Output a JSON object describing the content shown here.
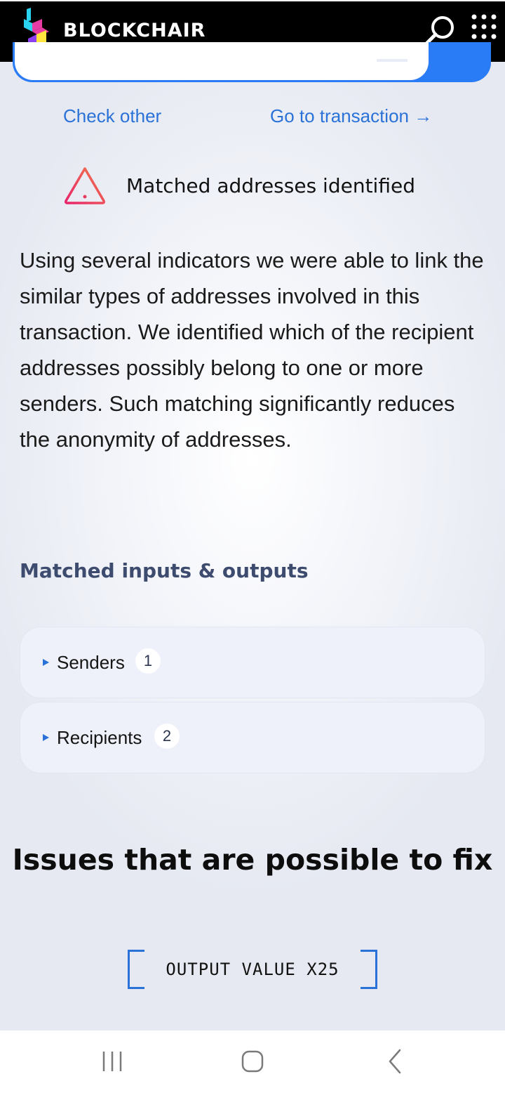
{
  "header": {
    "brand": "BLOCKCHAIR",
    "icons": [
      "blockchair-logo-icon",
      "search-icon",
      "apps-grid-icon"
    ],
    "colors": {
      "background": "#000000",
      "logo_cyan": "#2ad3f0",
      "logo_magenta": "#e83aa5",
      "logo_yellow": "#ffe53d",
      "logo_purple": "#8b3ff0"
    }
  },
  "search": {
    "accent": "#2a7cf6"
  },
  "links": {
    "check_other": "Check other",
    "go_to_transaction": "Go to transaction →"
  },
  "alert": {
    "title": "Matched addresses identified",
    "icon": "warning-triangle-icon",
    "body": "Using several indicators we were able to link the similar types of addresses involved in this transaction. We identified which of the recipient addresses possibly belong to one or more senders. Such matching significantly reduces the anonymity of addresses."
  },
  "matched": {
    "title": "Matched inputs & outputs",
    "groups": [
      {
        "label": "Senders",
        "count": "1"
      },
      {
        "label": "Recipients",
        "count": "2"
      }
    ]
  },
  "issues": {
    "title": "Issues that are possible to fix",
    "tag": "OUTPUT VALUE X25"
  },
  "navbar": {
    "icons": [
      "recent-apps-icon",
      "home-icon",
      "back-icon"
    ]
  }
}
